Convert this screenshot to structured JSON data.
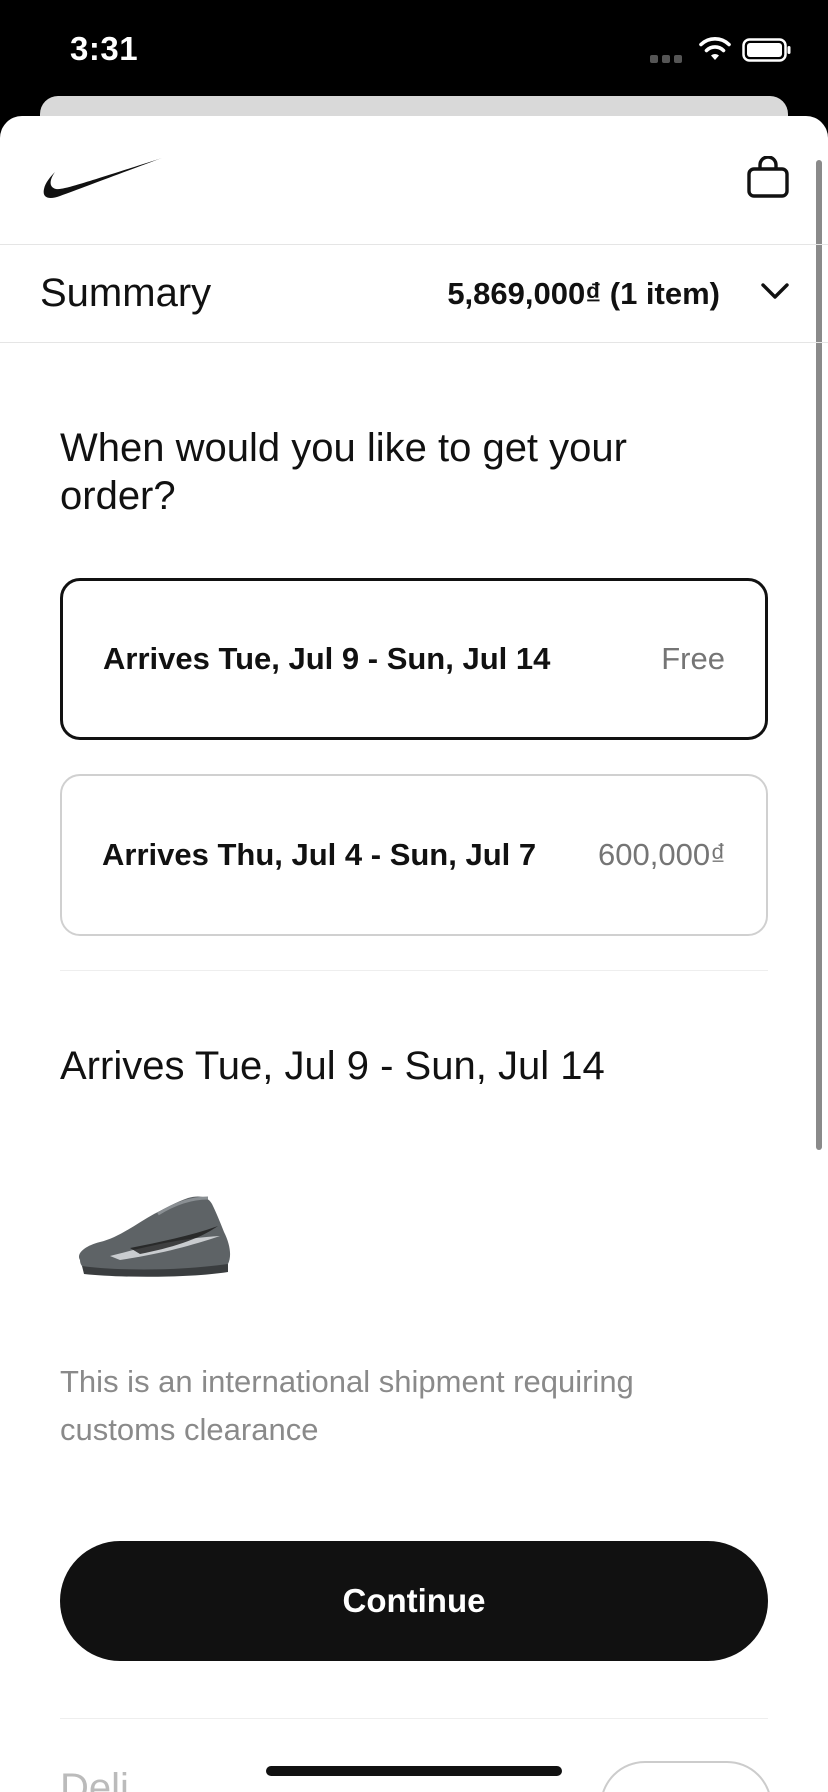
{
  "status_bar": {
    "time": "3:31",
    "icons": [
      "signal-icon",
      "wifi-icon",
      "battery-icon"
    ]
  },
  "header": {
    "logo": "nike-swoosh-logo",
    "cart_icon": "bag-icon"
  },
  "summary": {
    "title": "Summary",
    "total": "5,869,000₫ (1 item)",
    "toggle_icon": "chevron-down-icon"
  },
  "delivery": {
    "question": "When would you like to get your order?",
    "options": [
      {
        "label": "Arrives Tue, Jul 9 - Sun, Jul 14",
        "price": "Free",
        "selected": true
      },
      {
        "label": "Arrives Thu, Jul 4 - Sun, Jul 7",
        "price": "600,000₫",
        "selected": false
      }
    ],
    "selected_heading": "Arrives Tue, Jul 9 - Sun, Jul 14",
    "product_image": "grey-basketball-shoe",
    "customs_note": "This is an international shipment requiring customs clearance",
    "continue_label": "Continue"
  },
  "next_section": {
    "label": "Deli"
  },
  "colors": {
    "primary": "#111111",
    "muted_text": "#8a8a8a",
    "border_light": "#d0d0d0"
  }
}
